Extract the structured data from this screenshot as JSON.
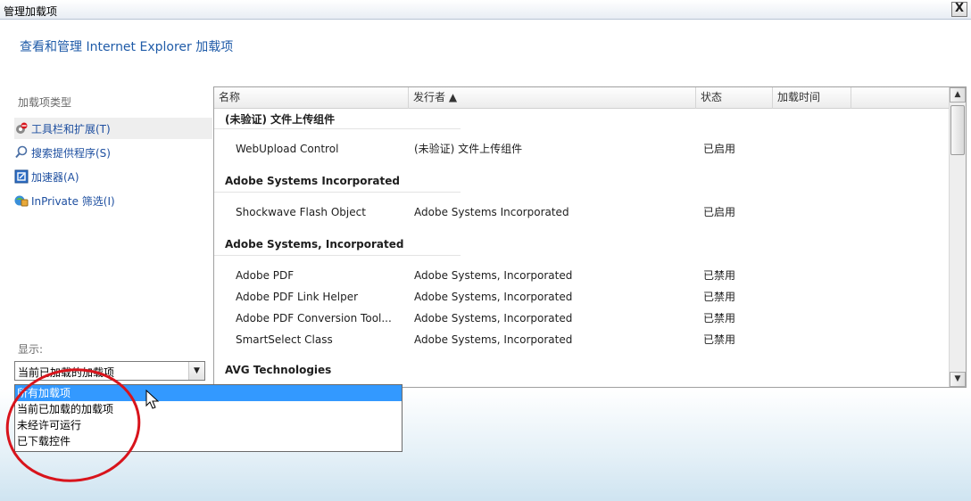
{
  "window": {
    "title": "管理加载项",
    "close_label": "X"
  },
  "header": {
    "heading": "查看和管理 Internet Explorer 加载项"
  },
  "sidebar": {
    "section_label": "加载项类型",
    "items": [
      {
        "label": "工具栏和扩展(T)",
        "icon": "toolbar-gear-icon"
      },
      {
        "label": "搜索提供程序(S)",
        "icon": "search-icon"
      },
      {
        "label": "加速器(A)",
        "icon": "accelerator-icon"
      },
      {
        "label": "InPrivate 筛选(I)",
        "icon": "inprivate-icon"
      }
    ],
    "show_label": "显示:",
    "show_select": {
      "value": "当前已加载的加载项",
      "options": [
        "所有加载项",
        "当前已加载的加载项",
        "未经许可运行",
        "已下载控件"
      ]
    }
  },
  "list": {
    "columns": [
      "名称",
      "发行者 ▲",
      "状态",
      "加载时间"
    ],
    "groups": [
      {
        "name": "(未验证) 文件上传组件",
        "rows": [
          {
            "name": "WebUpload Control",
            "publisher": "(未验证) 文件上传组件",
            "status": "已启用"
          }
        ]
      },
      {
        "name": "Adobe Systems Incorporated",
        "rows": [
          {
            "name": "Shockwave Flash Object",
            "publisher": "Adobe Systems Incorporated",
            "status": "已启用"
          }
        ]
      },
      {
        "name": "Adobe Systems, Incorporated",
        "rows": [
          {
            "name": "Adobe PDF",
            "publisher": "Adobe Systems, Incorporated",
            "status": "已禁用"
          },
          {
            "name": "Adobe PDF Link Helper",
            "publisher": "Adobe Systems, Incorporated",
            "status": "已禁用"
          },
          {
            "name": "Adobe PDF Conversion Tool...",
            "publisher": "Adobe Systems, Incorporated",
            "status": "已禁用"
          },
          {
            "name": "SmartSelect Class",
            "publisher": "Adobe Systems, Incorporated",
            "status": "已禁用"
          }
        ]
      },
      {
        "name": "AVG Technologies",
        "rows": []
      }
    ]
  },
  "colors": {
    "link": "#1e4fa0",
    "heading": "#1f5ba8",
    "selection": "#3399ff",
    "annotation": "#d8141c"
  }
}
